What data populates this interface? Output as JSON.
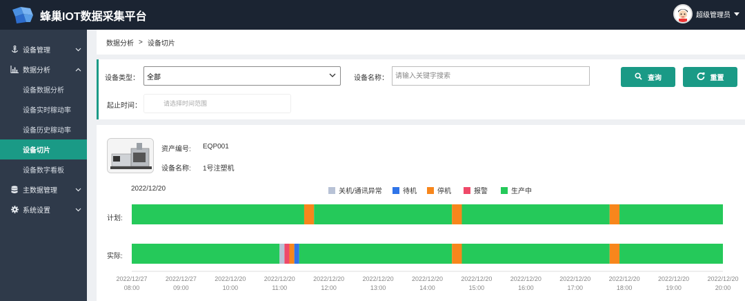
{
  "header": {
    "app_title": "蜂巢IOT数据采集平台",
    "user_name": "超级管理员"
  },
  "sidebar": {
    "items": [
      {
        "label": "设备管理",
        "icon": "anchor-icon",
        "expanded": false
      },
      {
        "label": "数据分析",
        "icon": "bar-chart-icon",
        "expanded": true,
        "children": [
          {
            "label": "设备数据分析"
          },
          {
            "label": "设备实时稼动率"
          },
          {
            "label": "设备历史稼动率"
          },
          {
            "label": "设备切片",
            "active": true
          },
          {
            "label": "设备数字看板"
          }
        ]
      },
      {
        "label": "主数据管理",
        "icon": "database-icon",
        "expanded": false
      },
      {
        "label": "系统设置",
        "icon": "gear-icon",
        "expanded": false
      }
    ]
  },
  "breadcrumb": {
    "parent": "数据分析",
    "separator": ">",
    "current": "设备切片"
  },
  "filters": {
    "device_type_label": "设备类型：",
    "device_type_value": "全部",
    "device_name_label": "设备名称：",
    "device_name_placeholder": "请输入关键字搜索",
    "time_range_label": "起止时间：",
    "time_range_placeholder": "请选择时间范围",
    "query_button": "查询",
    "reset_button": "重置"
  },
  "device": {
    "asset_no_label": "资产编号:",
    "asset_no": "EQP001",
    "name_label": "设备名称:",
    "name": "1号注塑机"
  },
  "chart_data": {
    "type": "timeline",
    "date": "2022/12/20",
    "legend": [
      {
        "name": "关机/通讯异常",
        "color": "#b8c2d6"
      },
      {
        "name": "待机",
        "color": "#2f74e8"
      },
      {
        "name": "停机",
        "color": "#f7861c"
      },
      {
        "name": "报警",
        "color": "#ef4969"
      },
      {
        "name": "生产中",
        "color": "#25c95a"
      }
    ],
    "x_ticks": [
      {
        "date": "2022/12/27",
        "time": "08:00"
      },
      {
        "date": "2022/12/27",
        "time": "09:00"
      },
      {
        "date": "2022/12/20",
        "time": "10:00"
      },
      {
        "date": "2022/12/20",
        "time": "11:00"
      },
      {
        "date": "2022/12/20",
        "time": "12:00"
      },
      {
        "date": "2022/12/20",
        "time": "13:00"
      },
      {
        "date": "2022/12/20",
        "time": "14:00"
      },
      {
        "date": "2022/12/20",
        "time": "15:00"
      },
      {
        "date": "2022/12/20",
        "time": "16:00"
      },
      {
        "date": "2022/12/20",
        "time": "17:00"
      },
      {
        "date": "2022/12/20",
        "time": "18:00"
      },
      {
        "date": "2022/12/20",
        "time": "19:00"
      },
      {
        "date": "2022/12/20",
        "time": "20:00"
      }
    ],
    "x_range": [
      "08:00",
      "20:00"
    ],
    "rows": [
      {
        "label": "计划:",
        "segments": [
          {
            "start": "08:00",
            "end": "11:30",
            "status": "生产中"
          },
          {
            "start": "11:30",
            "end": "11:42",
            "status": "停机"
          },
          {
            "start": "11:42",
            "end": "14:30",
            "status": "生产中"
          },
          {
            "start": "14:30",
            "end": "14:42",
            "status": "停机"
          },
          {
            "start": "14:42",
            "end": "17:42",
            "status": "生产中"
          },
          {
            "start": "17:42",
            "end": "17:54",
            "status": "停机"
          },
          {
            "start": "17:54",
            "end": "20:00",
            "status": "生产中"
          }
        ]
      },
      {
        "label": "实际:",
        "segments": [
          {
            "start": "08:00",
            "end": "11:00",
            "status": "生产中"
          },
          {
            "start": "11:00",
            "end": "11:06",
            "status": "关机/通讯异常"
          },
          {
            "start": "11:06",
            "end": "11:12",
            "status": "报警"
          },
          {
            "start": "11:12",
            "end": "11:18",
            "status": "停机"
          },
          {
            "start": "11:18",
            "end": "11:24",
            "status": "待机"
          },
          {
            "start": "11:24",
            "end": "14:30",
            "status": "生产中"
          },
          {
            "start": "14:30",
            "end": "14:42",
            "status": "停机"
          },
          {
            "start": "14:42",
            "end": "17:42",
            "status": "生产中"
          },
          {
            "start": "17:42",
            "end": "17:54",
            "status": "停机"
          },
          {
            "start": "17:54",
            "end": "20:00",
            "status": "生产中"
          }
        ]
      }
    ]
  }
}
